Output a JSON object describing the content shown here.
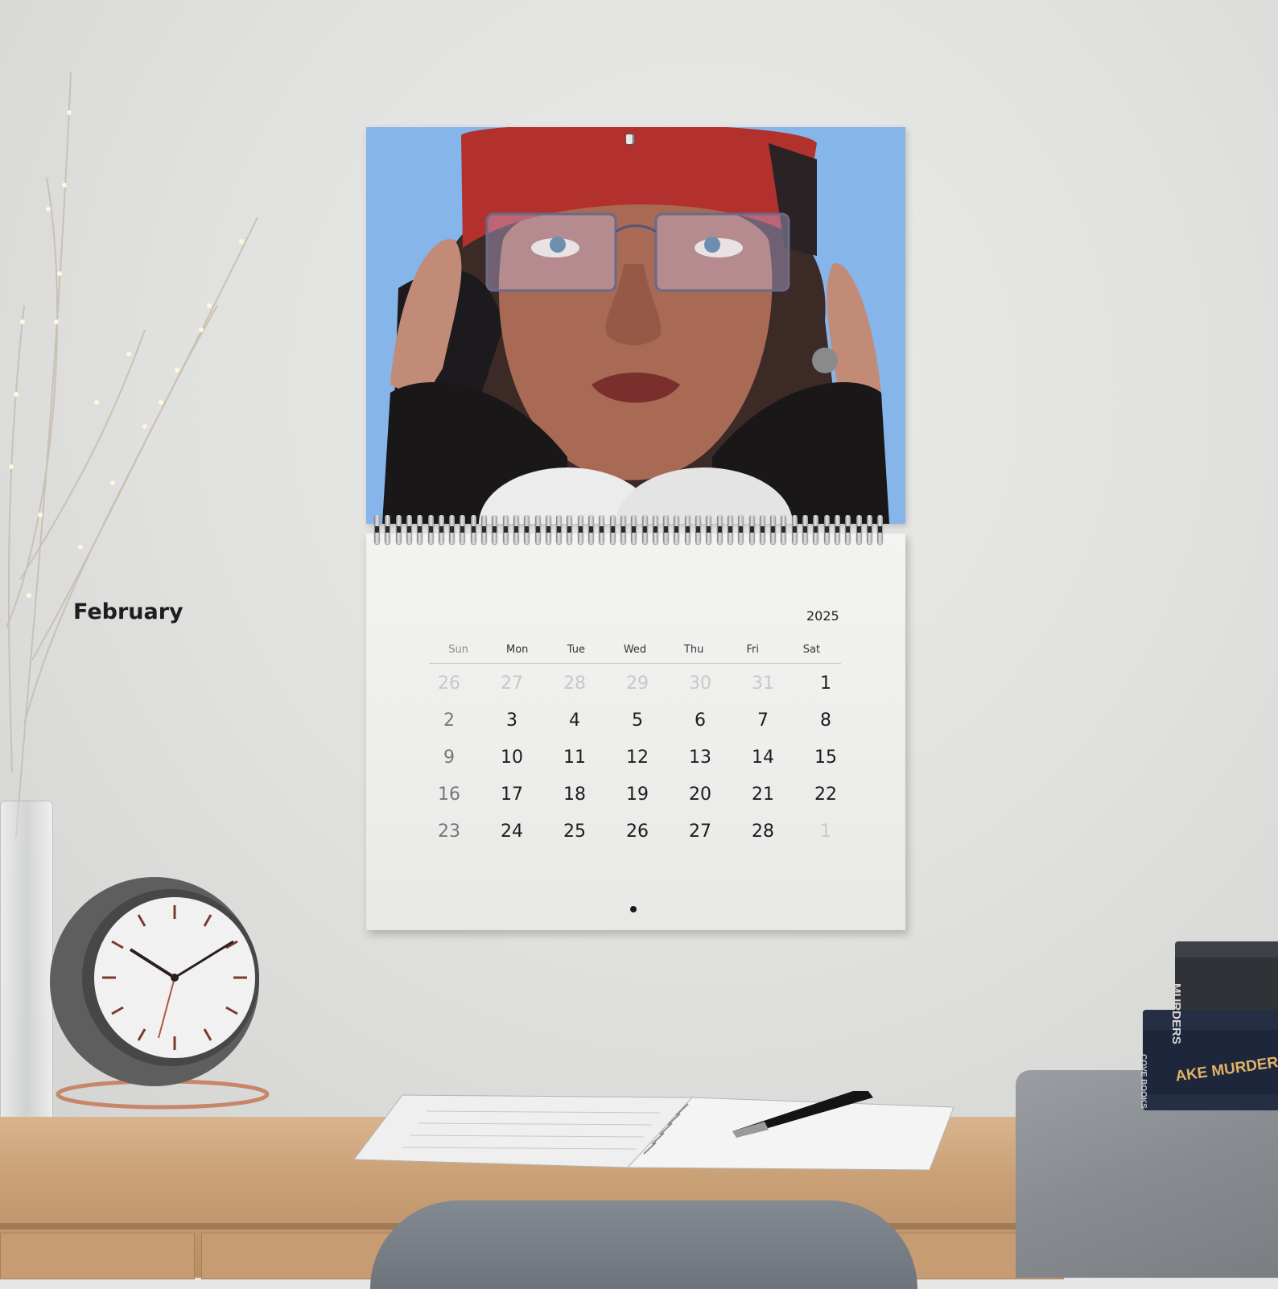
{
  "calendar": {
    "month": "February",
    "year": "2025",
    "weekdays": [
      "Sun",
      "Mon",
      "Tue",
      "Wed",
      "Thu",
      "Fri",
      "Sat"
    ],
    "weeks": [
      [
        "26",
        "27",
        "28",
        "29",
        "30",
        "31",
        "1"
      ],
      [
        "2",
        "3",
        "4",
        "5",
        "6",
        "7",
        "8"
      ],
      [
        "9",
        "10",
        "11",
        "12",
        "13",
        "14",
        "15"
      ],
      [
        "16",
        "17",
        "18",
        "19",
        "20",
        "21",
        "22"
      ],
      [
        "23",
        "24",
        "25",
        "26",
        "27",
        "28",
        "1"
      ]
    ]
  },
  "books": {
    "top_spine": "MURDERS",
    "bottom_spine": "AKE MURDERS",
    "bottom_publisher": "COVE BOOKS"
  },
  "colors": {
    "photo_sky": "#7fb1ea",
    "cap": "#b2312c",
    "desk": "#c99f75",
    "wall": "#e2e2e0"
  }
}
